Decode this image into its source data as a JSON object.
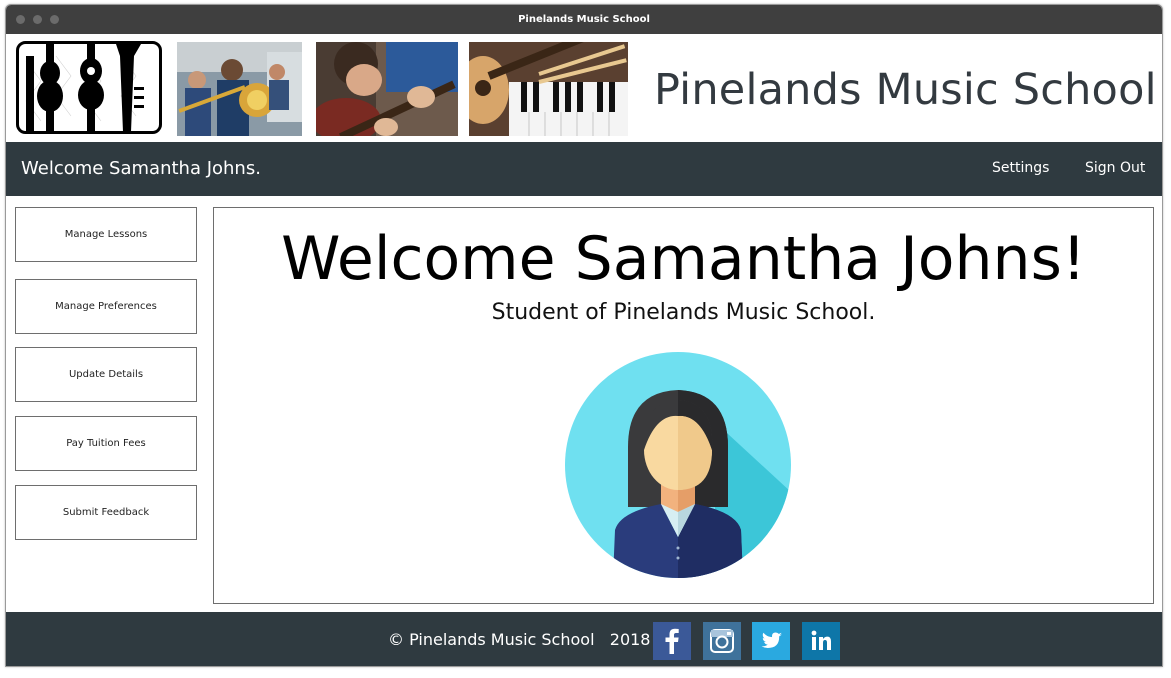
{
  "window": {
    "title": "Pinelands Music School"
  },
  "header": {
    "site_name": "Pinelands Music School",
    "logo_icon": "instrument-silhouettes-logo",
    "photos": [
      "brass-band-students-photo",
      "guitar-student-photo",
      "ukulele-keyboard-photo"
    ]
  },
  "navbar": {
    "welcome": "Welcome Samantha Johns.",
    "settings_label": "Settings",
    "signout_label": "Sign Out"
  },
  "sidebar": {
    "items": [
      {
        "label": "Manage Lessons"
      },
      {
        "label": "Manage Preferences"
      },
      {
        "label": "Update Details"
      },
      {
        "label": "Pay Tuition Fees"
      },
      {
        "label": "Submit Feedback"
      }
    ]
  },
  "main": {
    "heading": "Welcome Samantha Johns!",
    "subheading": "Student of Pinelands Music School.",
    "avatar_icon": "female-student-avatar-icon"
  },
  "footer": {
    "copyright": "© Pinelands Music School   2018",
    "social": [
      {
        "icon": "facebook-icon",
        "color": "#3b5998"
      },
      {
        "icon": "instagram-icon",
        "color": "#3f729b"
      },
      {
        "icon": "twitter-icon",
        "color": "#2aa9e0"
      },
      {
        "icon": "linkedin-icon",
        "color": "#0e76a8"
      }
    ]
  },
  "colors": {
    "titlebar": "#3f3f3f",
    "navbar": "#2f3a40",
    "footer": "#2f3a40",
    "avatar_circle": "#6fe0f0"
  }
}
